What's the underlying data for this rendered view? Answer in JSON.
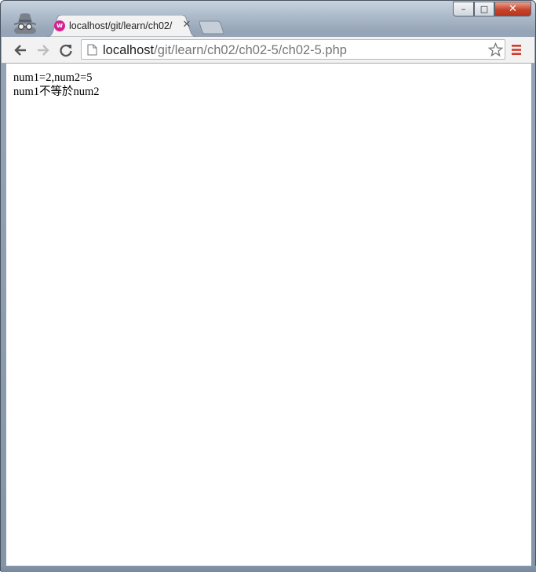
{
  "window": {
    "minimize_glyph": "–",
    "maximize_glyph": "□",
    "close_glyph": "✕"
  },
  "tabs": [
    {
      "title": "localhost/git/learn/ch02/",
      "favicon_letter": "w",
      "favicon_color": "#d6208e",
      "close_glyph": "✕"
    }
  ],
  "toolbar": {
    "url_host": "localhost",
    "url_path": "/git/learn/ch02/ch02-5/ch02-5.php",
    "icons": [
      "back-icon",
      "forward-icon",
      "reload-icon",
      "page-icon",
      "bookmark-star-icon",
      "menu-icon"
    ]
  },
  "page": {
    "line1": "num1=2,num2=5",
    "line2": "num1不等於num2"
  },
  "colors": {
    "frame": "#95a4b6",
    "toolbar": "#f2f2f2",
    "menu_accent": "#d23a2c"
  }
}
